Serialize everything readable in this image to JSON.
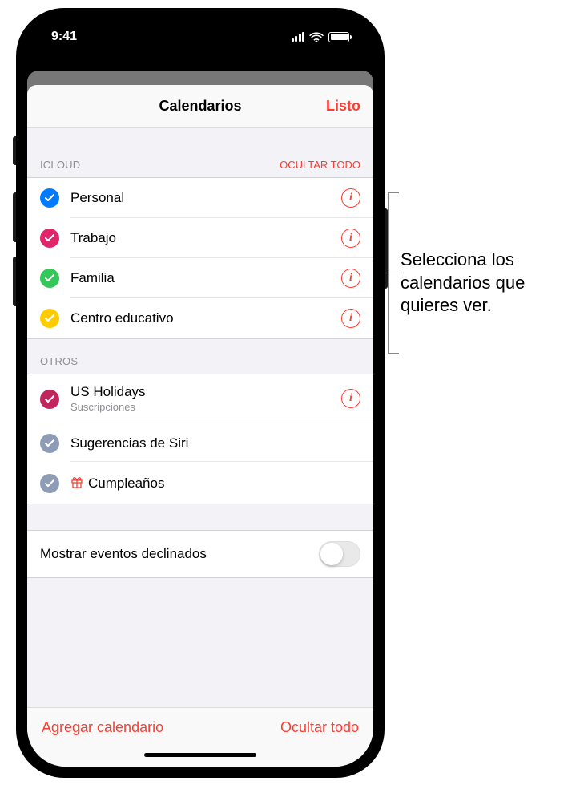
{
  "status_bar": {
    "time": "9:41"
  },
  "modal": {
    "title": "Calendarios",
    "done": "Listo"
  },
  "sections": {
    "icloud": {
      "label": "ICLOUD",
      "action": "OCULTAR TODO",
      "items": [
        {
          "label": "Personal",
          "color": "#007aff"
        },
        {
          "label": "Trabajo",
          "color": "#e2246b"
        },
        {
          "label": "Familia",
          "color": "#34c759"
        },
        {
          "label": "Centro educativo",
          "color": "#ffcc00"
        }
      ]
    },
    "others": {
      "label": "OTROS",
      "items": [
        {
          "label": "US Holidays",
          "sub": "Suscripciones",
          "color": "#c2255c",
          "info": true
        },
        {
          "label": "Sugerencias de Siri",
          "color": "#8e9db5",
          "info": false
        },
        {
          "label": "Cumpleaños",
          "color": "#8e9db5",
          "info": false,
          "icon": "gift"
        }
      ]
    }
  },
  "declined_row": {
    "label": "Mostrar eventos declinados",
    "on": false
  },
  "footer": {
    "add": "Agregar calendario",
    "hide_all": "Ocultar todo"
  },
  "callout": "Selecciona los calendarios que quieres ver."
}
